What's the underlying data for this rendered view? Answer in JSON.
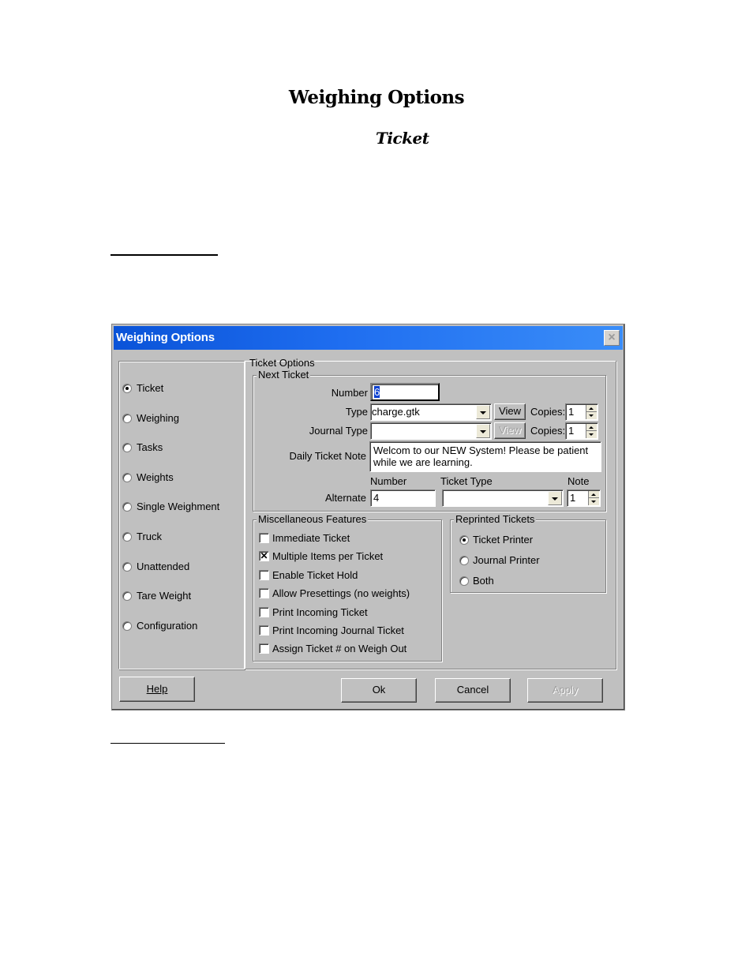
{
  "document": {
    "title": "Weighing Options",
    "subtitle": "Ticket"
  },
  "window": {
    "title": "Weighing Options",
    "close_icon": "close-icon",
    "categories": [
      {
        "label": "Ticket",
        "selected": true
      },
      {
        "label": "Weighing",
        "selected": false
      },
      {
        "label": "Tasks",
        "selected": false
      },
      {
        "label": "Weights",
        "selected": false
      },
      {
        "label": "Single Weighment",
        "selected": false
      },
      {
        "label": "Truck",
        "selected": false
      },
      {
        "label": "Unattended",
        "selected": false
      },
      {
        "label": "Tare Weight",
        "selected": false
      },
      {
        "label": "Configuration",
        "selected": false
      }
    ],
    "ticket_options": {
      "legend": "Ticket Options",
      "next_ticket": {
        "legend": "Next Ticket",
        "number_label": "Number",
        "number_value": "6",
        "type_label": "Type",
        "type_value": "charge.gtk",
        "view_label": "View",
        "copies_label": "Copies:",
        "type_copies": "1",
        "journal_type_label": "Journal Type",
        "journal_type_value": "",
        "journal_view_label": "View",
        "journal_copies": "1",
        "daily_note_label": "Daily Ticket Note",
        "daily_note_value": "Welcom to our NEW System! Please be patient while we are learning.",
        "alt_number_header": "Number",
        "alt_ticket_type_header": "Ticket Type",
        "alt_note_header": "Note",
        "alternate_label": "Alternate",
        "alternate_number": "4",
        "alternate_ticket_type": "",
        "alternate_note": "1"
      },
      "misc": {
        "legend": "Miscellaneous Features",
        "items": [
          {
            "label": "Immediate Ticket",
            "checked": false,
            "mark": ""
          },
          {
            "label": "Multiple Items per Ticket",
            "checked": true,
            "mark": "✕"
          },
          {
            "label": "Enable Ticket Hold",
            "checked": false,
            "mark": ""
          },
          {
            "label": "Allow Presettings (no weights)",
            "checked": false,
            "mark": ""
          },
          {
            "label": "Print Incoming Ticket",
            "checked": false,
            "mark": ""
          },
          {
            "label": "Print Incoming Journal Ticket",
            "checked": false,
            "mark": ""
          },
          {
            "label": "Assign Ticket # on Weigh Out",
            "checked": false,
            "mark": ""
          }
        ]
      },
      "reprinted": {
        "legend": "Reprinted Tickets",
        "options": [
          {
            "label": "Ticket Printer",
            "selected": true
          },
          {
            "label": "Journal Printer",
            "selected": false
          },
          {
            "label": "Both",
            "selected": false
          }
        ]
      }
    },
    "buttons": {
      "help": "Help",
      "ok": "Ok",
      "cancel": "Cancel",
      "apply": "Apply"
    }
  }
}
